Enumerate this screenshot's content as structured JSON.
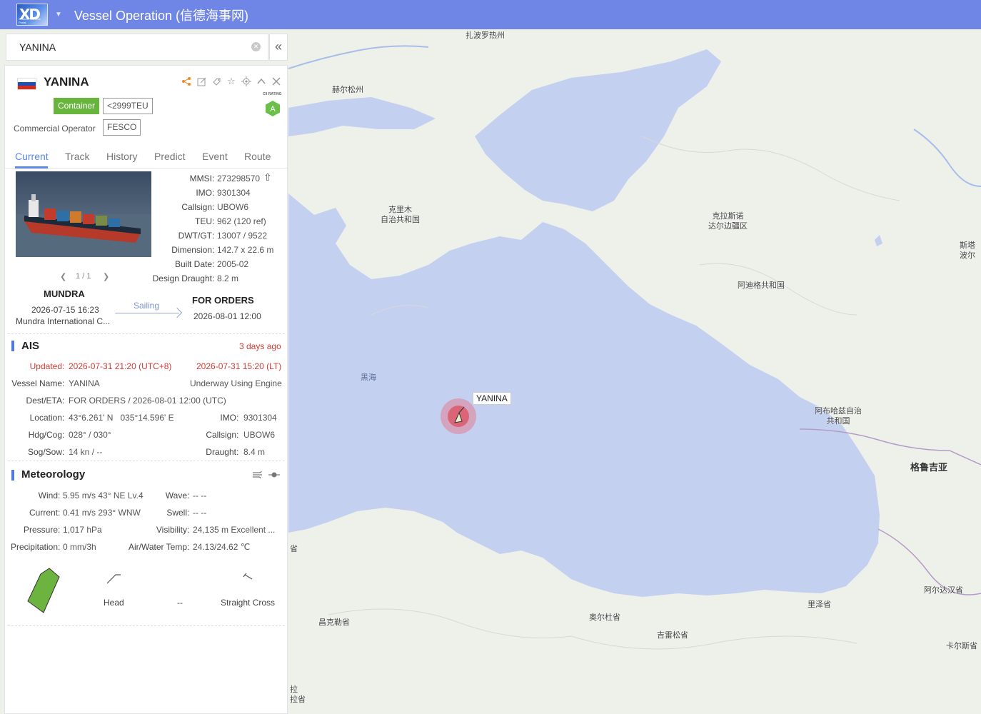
{
  "app": {
    "title": "Vessel Operation (信德海事网)",
    "logo_text": "XD",
    "logo_sub": "Xindeco Maritime Portal"
  },
  "search": {
    "value": "YANINA",
    "clear_icon": "clear-icon",
    "collapse_icon": "double-chevron-left-icon"
  },
  "vessel": {
    "name": "YANINA",
    "flag_colors": [
      "#ffffff",
      "#1f4fb5",
      "#d52b1e"
    ],
    "type_tag": "Container",
    "size_tag": "<2999TEU",
    "commercial_operator_label": "Commercial Operator",
    "commercial_operator": "FESCO",
    "cii_label": "CII RATING",
    "cii_rating": "A",
    "header_icons": [
      "share-icon",
      "edit-icon",
      "tag-icon",
      "star-icon",
      "locate-icon",
      "chevron-up-icon",
      "close-icon"
    ]
  },
  "tabs": [
    {
      "label": "Current",
      "active": true
    },
    {
      "label": "Track"
    },
    {
      "label": "History"
    },
    {
      "label": "Predict"
    },
    {
      "label": "Event"
    },
    {
      "label": "Route"
    }
  ],
  "photo": {
    "pager": "1 / 1"
  },
  "particulars": [
    {
      "key": "MMSI",
      "value": "273298570"
    },
    {
      "key": "IMO",
      "value": "9301304"
    },
    {
      "key": "Callsign",
      "value": "UBOW6"
    },
    {
      "key": "TEU",
      "value": "962 (120 ref)"
    },
    {
      "key": "DWT/GT",
      "value": "13007 / 9522"
    },
    {
      "key": "Dimension",
      "value": "142.7 x 22.6 m"
    },
    {
      "key": "Built Date",
      "value": "2005-02"
    },
    {
      "key": "Design Draught",
      "value": "8.2 m"
    }
  ],
  "route": {
    "from_port": "MUNDRA",
    "from_time": "2026-07-15 16:23",
    "from_terminal": "Mundra International C...",
    "status": "Sailing",
    "to_port": "FOR ORDERS",
    "to_time": "2026-08-01 12:00"
  },
  "ais": {
    "title": "AIS",
    "ago": "3 days ago",
    "updated_label": "Updated",
    "updated_utc": "2026-07-31 21:20 (UTC+8)",
    "updated_lt": "2026-07-31 15:20 (LT)",
    "vessel_name_label": "Vessel Name",
    "vessel_name": "YANINA",
    "nav_status": "Underway Using Engine",
    "dest_label": "Dest/ETA",
    "dest_value": "FOR ORDERS / 2026-08-01 12:00 (UTC)",
    "location_label": "Location",
    "location_value": "43°6.261' N   035°14.596' E",
    "imo_label": "IMO",
    "imo_value": "9301304",
    "hdg_label": "Hdg/Cog",
    "hdg_value": "028° / 030°",
    "callsign_label": "Callsign",
    "callsign_value": "UBOW6",
    "sog_label": "Sog/Sow",
    "sog_value": "14 kn / --",
    "draught_label": "Draught",
    "draught_value": "8.4 m"
  },
  "meteorology": {
    "title": "Meteorology",
    "icons": [
      "wind-icon",
      "settings-slider-icon"
    ],
    "wind_label": "Wind",
    "wind_value": "5.95 m/s 43° NE Lv.4",
    "wave_label": "Wave",
    "wave_value": "-- --",
    "current_label": "Current",
    "current_value": "0.41 m/s 293° WNW",
    "swell_label": "Swell",
    "swell_value": "-- --",
    "pressure_label": "Pressure",
    "pressure_value": "1,017 hPa",
    "visibility_label": "Visibility",
    "visibility_value": "24,135 m Excellent ...",
    "precip_label": "Precipitation",
    "precip_value": "0 mm/3h",
    "temp_label": "Air/Water Temp",
    "temp_value": "24.13/24.62 ℃",
    "wind_relative": "Head",
    "wave_relative": "--",
    "current_relative": "Straight Cross"
  },
  "map": {
    "vessel_label": "YANINA",
    "labels": [
      {
        "text": "扎波罗热州",
        "kind": "land"
      },
      {
        "text": "赫尔松州",
        "kind": "land"
      },
      {
        "text": "克里木\n自治共和国",
        "kind": "land"
      },
      {
        "text": "克拉斯诺\n达尔边疆区",
        "kind": "land"
      },
      {
        "text": "阿迪格共和国",
        "kind": "land"
      },
      {
        "text": "斯塔\n波尔",
        "kind": "land"
      },
      {
        "text": "黑海",
        "kind": "sea"
      },
      {
        "text": "阿布哈兹自治\n共和国",
        "kind": "land"
      },
      {
        "text": "格鲁吉亚",
        "kind": "big"
      },
      {
        "text": "阿尔达汉省",
        "kind": "land"
      },
      {
        "text": "里泽省",
        "kind": "land"
      },
      {
        "text": "卡尔斯省",
        "kind": "land"
      },
      {
        "text": "奥尔杜省",
        "kind": "land"
      },
      {
        "text": "吉雷松省",
        "kind": "land"
      },
      {
        "text": "昌克勒省",
        "kind": "land"
      },
      {
        "text": "省",
        "kind": "land"
      },
      {
        "text": "拉\n拉省",
        "kind": "land"
      }
    ],
    "sea_color": "#c3d0f0",
    "land_color": "#eef0ea"
  }
}
